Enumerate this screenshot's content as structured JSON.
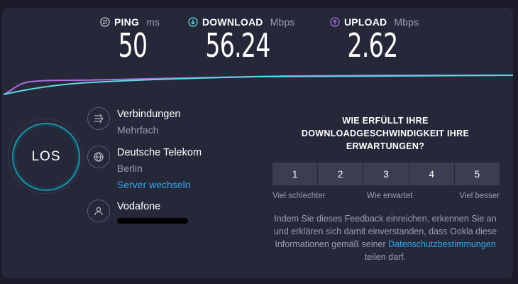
{
  "metrics": {
    "ping": {
      "label": "PING",
      "unit": "ms",
      "value": "50"
    },
    "download": {
      "label": "DOWNLOAD",
      "unit": "Mbps",
      "value": "56.24"
    },
    "upload": {
      "label": "UPLOAD",
      "unit": "Mbps",
      "value": "2.62"
    }
  },
  "colors": {
    "download": "#5fd6e2",
    "upload": "#a86ee3",
    "accent": "#2ea8e8"
  },
  "go_button": {
    "label": "LOS"
  },
  "connections": {
    "title": "Verbindungen",
    "value": "Mehrfach"
  },
  "server": {
    "provider": "Deutsche Telekom",
    "city": "Berlin",
    "change_link": "Server wechseln"
  },
  "isp": {
    "name": "Vodafone"
  },
  "feedback": {
    "question": "WIE ERFÜLLT IHRE DOWNLOADGESCHWINDIGKEIT IHRE ERWARTUNGEN?",
    "ratings": [
      "1",
      "2",
      "3",
      "4",
      "5"
    ],
    "label_low": "Viel schlechter",
    "label_mid": "Wie erwartet",
    "label_high": "Viel besser",
    "note_before": "Indem Sie dieses Feedback einreichen, erkennen Sie an und erklären sich damit einverstanden, dass Ookla diese Informationen gemäß seiner",
    "privacy_link": "Datenschutzbestimmungen",
    "note_after": "teilen darf."
  }
}
